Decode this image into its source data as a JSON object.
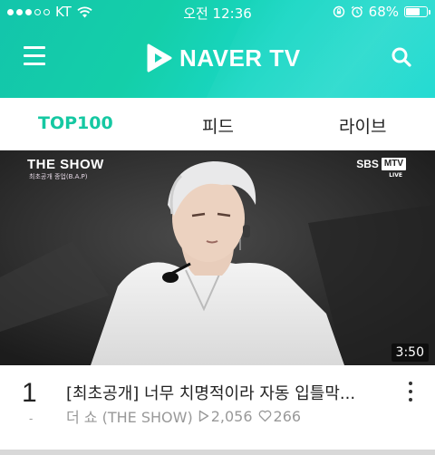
{
  "status_bar": {
    "carrier": "KT",
    "time": "오전 12:36",
    "battery": "68%",
    "battery_level": 0.68
  },
  "navbar": {
    "logo_text": "NAVER TV",
    "brand_color": "#15c8a2"
  },
  "tabs": [
    {
      "label": "TOP100",
      "active": true
    },
    {
      "label": "피드",
      "active": false
    },
    {
      "label": "라이브",
      "active": false
    }
  ],
  "video": {
    "show_logo": "THE SHOW",
    "show_caption": "최초공개   종업(B.A.P)",
    "broadcaster": "SBS",
    "channel": "MTV",
    "channel_tag": "LIVE",
    "duration": "3:50"
  },
  "item": {
    "rank": "1",
    "rank_change": "-",
    "title": "[최초공개] 너무 치명적이라 자동 입틀막...",
    "channel": "더 쇼 (THE SHOW)",
    "views": "2,056",
    "likes": "266"
  }
}
